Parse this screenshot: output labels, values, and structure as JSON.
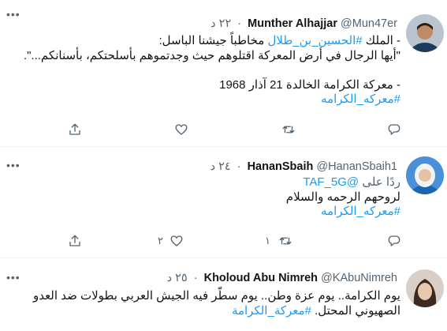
{
  "tweets": [
    {
      "name": "Munther Alhajjar",
      "handle": "@Mun47er",
      "time": "٢٢ د",
      "lines": [
        {
          "text": "- الملك ",
          "tag": "#الحسين_بن_طلال",
          "rest": " مخاطباً جيشنا الباسل:"
        },
        {
          "text": "\"أيها الرجال في أرض المعركة اقتلوهم حيث وجدتموهم بأسلحتكم، بأسنانكم...\"."
        },
        {
          "text": ""
        },
        {
          "text": "- معركة الكرامة الخالدة 21 آذار 1968"
        },
        {
          "tag": "#معركه_الكرامه"
        }
      ],
      "likes": "",
      "retweets": "",
      "replies": "",
      "avatar_colors": {
        "bg": "#b9c4cf",
        "skin": "#c08a66",
        "shirt": "#1c3b5a"
      }
    },
    {
      "name": "HananSbaih",
      "handle": "@HananSbaih1",
      "time": "٢٤ د",
      "reply_prefix": "ردًا على",
      "reply_to": "@TAF_5G",
      "lines": [
        {
          "text": "لروحهم الرحمه والسلام"
        },
        {
          "tag": "#معركه_الكرامه"
        }
      ],
      "likes": "٢",
      "retweets": "١",
      "replies": "",
      "avatar_colors": {
        "bg": "#4a90d9",
        "skin": "#e3c3a6",
        "shirt": "#1a66b5"
      }
    },
    {
      "name": "Kholoud Abu Nimreh",
      "handle": "@KAbuNimreh",
      "time": "٢٥ د",
      "lines": [
        {
          "text": "يوم الكرامة.. يوم عزة وطن.. يوم سطّر فيه الجيش العربي بطولات ضد العدو"
        },
        {
          "text": "الصهيوني المحتل. ",
          "tag": "#معركة_الكرامة"
        }
      ],
      "avatar_colors": {
        "bg": "#d9cfc7",
        "skin": "#e8c9ae",
        "hair": "#3a2a20"
      }
    }
  ],
  "colors": {
    "accent": "#1d9bf0",
    "muted": "#536471",
    "text": "#0f1419",
    "divider": "#eff3f4"
  },
  "icons": [
    "more-icon",
    "share-icon",
    "like-icon",
    "retweet-icon",
    "reply-icon"
  ]
}
